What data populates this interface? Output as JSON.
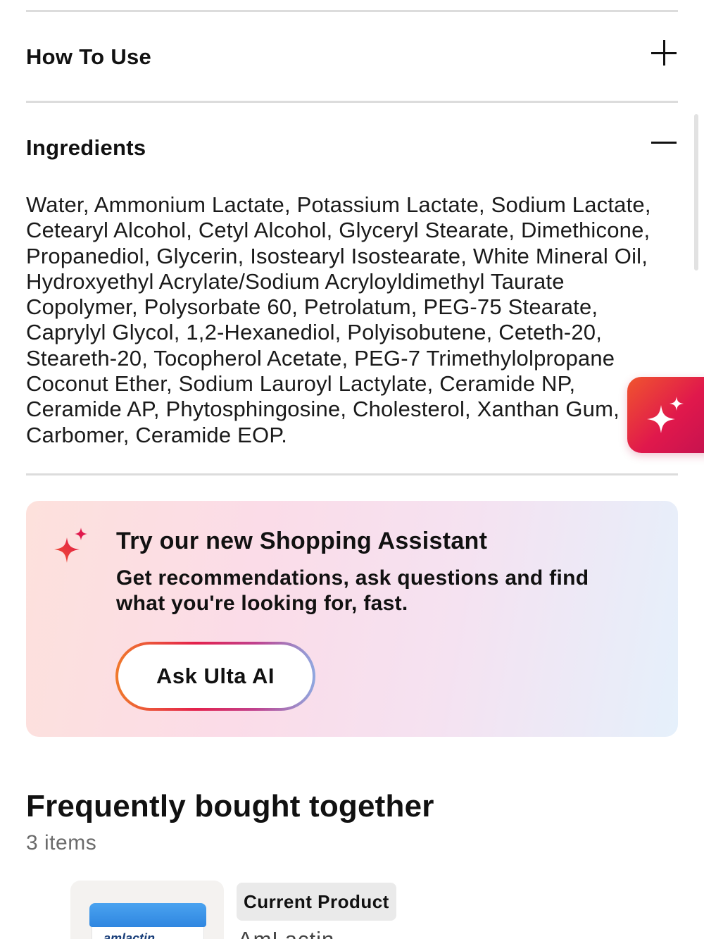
{
  "accordion": {
    "how_to_use": {
      "title": "How To Use",
      "state": "collapsed",
      "icon": "plus-icon"
    },
    "ingredients": {
      "title": "Ingredients",
      "state": "expanded",
      "icon": "minus-icon",
      "text": "Water, Ammonium Lactate, Potassium Lactate, Sodium Lactate, Cetearyl Alcohol, Cetyl Alcohol, Glyceryl Stearate, Dimethicone, Propanediol, Glycerin, Isostearyl Isostearate, White Mineral Oil, Hydroxyethyl Acrylate/Sodium Acryloyldimethyl Taurate Copolymer, Polysorbate 60, Petrolatum, PEG-75 Stearate, Caprylyl Glycol, 1,2-Hexanediol, Polyisobutene, Ceteth-20, Steareth-20, Tocopherol Acetate, PEG-7 Trimethylolpropane Coconut Ether, Sodium Lauroyl Lactylate, Ceramide NP, Ceramide AP, Phytosphingosine, Cholesterol, Xanthan Gum, Carbomer, Ceramide EOP."
    }
  },
  "assistant": {
    "title": "Try our new Shopping Assistant",
    "subtitle": "Get recommendations, ask questions and find what you're looking for, fast.",
    "button_label": "Ask Ulta AI",
    "icon": "sparkle-icon"
  },
  "fab": {
    "icon": "sparkle-icon"
  },
  "frequently_bought": {
    "title": "Frequently bought together",
    "count": "3 items",
    "products": [
      {
        "badge": "Current Product",
        "name": "AmLactin",
        "thumb_label": "amlactin"
      }
    ]
  },
  "colors": {
    "text": "#111111",
    "divider": "#dcdcdc",
    "brand_gradient_start": "#f0552e",
    "brand_gradient_end": "#c4124f",
    "card_gradient": [
      "#fde1dc",
      "#fbdce8",
      "#e5f0fb"
    ]
  }
}
